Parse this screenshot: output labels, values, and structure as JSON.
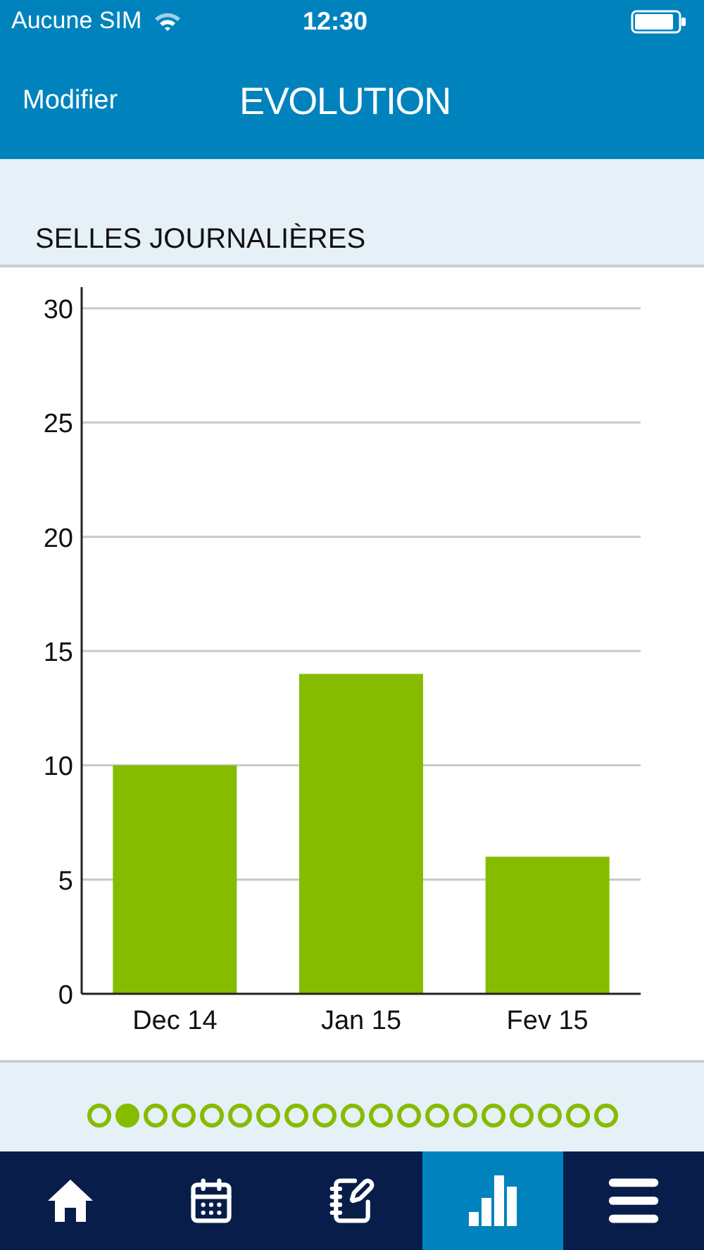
{
  "status_bar": {
    "carrier": "Aucune SIM",
    "time": "12:30"
  },
  "nav_bar": {
    "left_button": "Modifier",
    "title": "EVOLUTION"
  },
  "section": {
    "title": "SELLES JOURNALIÈRES",
    "chart_data": {
      "type": "bar",
      "categories": [
        "Dec 14",
        "Jan 15",
        "Fev 15"
      ],
      "series": [
        {
          "color": "#86bc00",
          "values": [
            10,
            14,
            6
          ]
        }
      ],
      "grid": true,
      "ylim": [
        0,
        30
      ],
      "yticks": [
        0,
        5,
        10,
        15,
        20,
        25,
        30
      ]
    }
  },
  "page_dots": [
    {
      "selected": false
    },
    {
      "selected": true
    },
    {
      "selected": false
    },
    {
      "selected": false
    },
    {
      "selected": false
    },
    {
      "selected": false
    },
    {
      "selected": false
    },
    {
      "selected": false
    },
    {
      "selected": false
    },
    {
      "selected": false
    },
    {
      "selected": false
    },
    {
      "selected": false
    },
    {
      "selected": false
    },
    {
      "selected": false
    },
    {
      "selected": false
    },
    {
      "selected": false
    },
    {
      "selected": false
    },
    {
      "selected": false
    },
    {
      "selected": false
    }
  ],
  "tab_bar": [
    {
      "kind": "home",
      "selected": false
    },
    {
      "kind": "calendar",
      "selected": false
    },
    {
      "kind": "notes",
      "selected": false
    },
    {
      "kind": "chart",
      "selected": true
    },
    {
      "kind": "menu",
      "selected": false
    }
  ]
}
